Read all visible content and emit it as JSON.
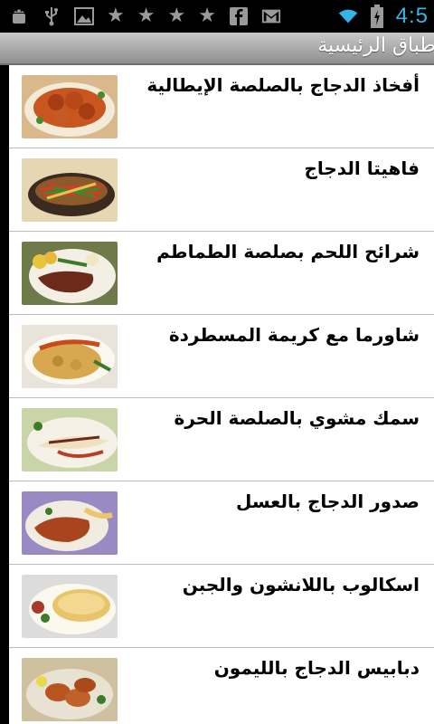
{
  "status_bar": {
    "icons": [
      "android-debug-icon",
      "usb-icon",
      "image-icon",
      "star-icon",
      "star-icon",
      "star-icon",
      "star-icon",
      "facebook-icon",
      "gmail-icon"
    ],
    "time": "4:5",
    "accent": "#33b5e5"
  },
  "app": {
    "title": "أطباق الرئيسية"
  },
  "recipes": [
    {
      "name": "أفخاذ الدجاج بالصلصة الإيطالية",
      "thumb": "chicken-thighs-image"
    },
    {
      "name": "فاهيتا الدجاج",
      "thumb": "chicken-fajita-image"
    },
    {
      "name": "شرائح اللحم بصلصة الطماطم",
      "thumb": "beef-steak-image"
    },
    {
      "name": "شاورما مع كريمة المسطردة",
      "thumb": "shawarma-image"
    },
    {
      "name": "سمك مشوي بالصلصة الحرة",
      "thumb": "grilled-fish-image"
    },
    {
      "name": "صدور الدجاج بالعسل",
      "thumb": "honey-chicken-image"
    },
    {
      "name": "اسكالوب باللانشون والجبن",
      "thumb": "escalope-image"
    },
    {
      "name": "دبابيس الدجاج بالليمون",
      "thumb": "chicken-drumsticks-image"
    }
  ]
}
